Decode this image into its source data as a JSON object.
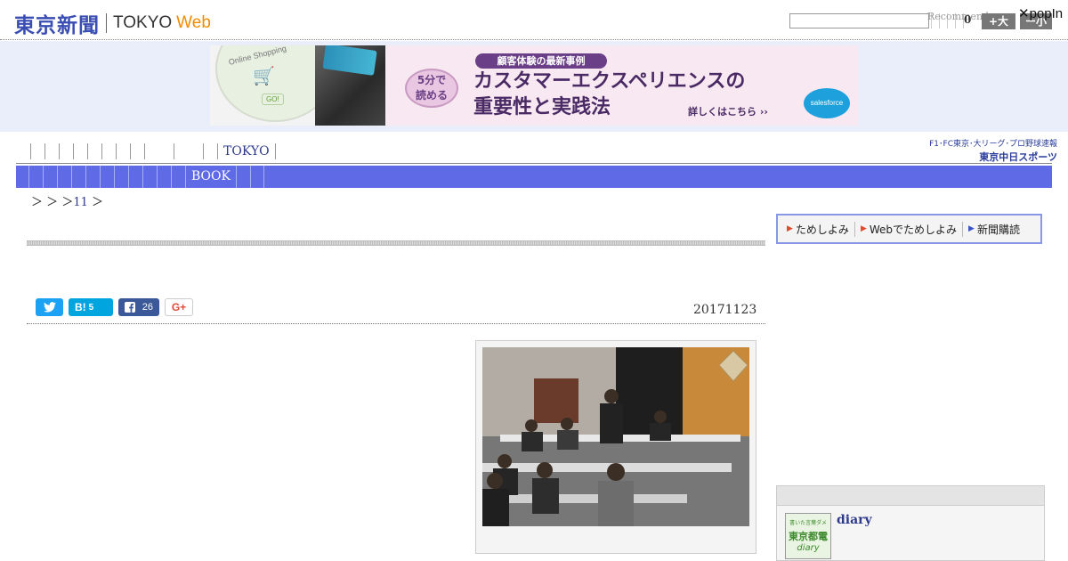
{
  "header": {
    "logo_jp": "東京新聞",
    "logo_tokyo": "TOKYO",
    "logo_web": "Web",
    "recommend_text": "Recommend",
    "recommend_count": "0",
    "font_larger": "+大",
    "font_smaller": "ー小",
    "popin": "✕popIn"
  },
  "ad": {
    "online_shopping": "Online Shopping",
    "go": "GO!",
    "bubble": "5分で\n読める",
    "tag": "顧客体験の最新事例",
    "headline_line1": "カスタマーエクスペリエンスの",
    "headline_line2": "重要性と実践法",
    "cta": "詳しくはこちら ››",
    "salesforce": "salesforce"
  },
  "nav_top": {
    "empty_count": 13,
    "tokyo_label": "TOKYO",
    "chunichi_line1": "F1･FC東京･大リーグ･プロ野球速報",
    "chunichi_logo": "東京中日スポーツ"
  },
  "nav_main": {
    "book_label": "BOOK"
  },
  "breadcrumb": {
    "sep1": "＞",
    "sep2": "＞",
    "sep3": "＞",
    "link": "11",
    "sep4": "＞"
  },
  "subscribe": {
    "trial": "ためしよみ",
    "web_trial": "Webでためしよみ",
    "subscribe": "新聞購読"
  },
  "share": {
    "hatena_label": "B!",
    "hatena_count": "5",
    "facebook_count": "26",
    "googleplus_label": "G+"
  },
  "article": {
    "date": "20171123"
  },
  "sidebar": {
    "diary_thumb_line1": "書いた言葉ダメ",
    "diary_thumb_line2": "東京都電",
    "diary_thumb_line3": "diary",
    "diary_title": "diary"
  }
}
